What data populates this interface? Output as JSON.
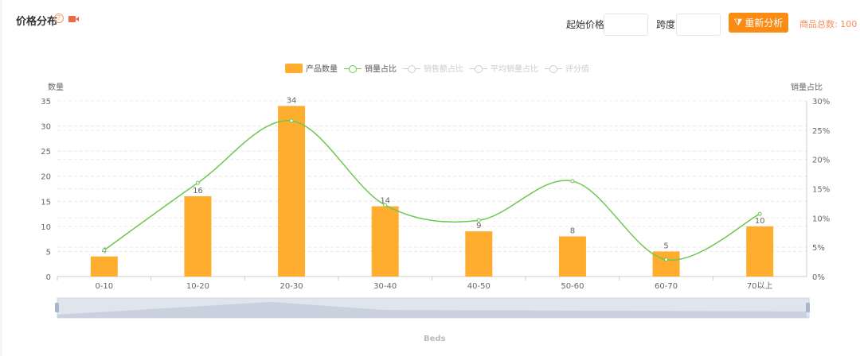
{
  "header": {
    "title": "价格分布",
    "help_icon": "?",
    "start_price_label": "起始价格",
    "start_price_value": "",
    "span_label": "跨度",
    "span_value": "",
    "reanalyze_label": "重新分析",
    "total_label": "商品总数: 100"
  },
  "colors": {
    "bar": "#ffad2e",
    "line": "#6cc84f",
    "accent": "#fa8c16"
  },
  "chart_data": {
    "type": "bar",
    "categories": [
      "0-10",
      "10-20",
      "20-30",
      "30-40",
      "40-50",
      "50-60",
      "60-70",
      "70以上"
    ],
    "series": [
      {
        "name": "产品数量",
        "type": "bar",
        "values": [
          4,
          16,
          34,
          14,
          9,
          8,
          5,
          10
        ],
        "active": true
      },
      {
        "name": "销量占比",
        "type": "line",
        "values": [
          4.5,
          16,
          26.6,
          12.2,
          9.6,
          16.3,
          2.9,
          10.7
        ],
        "active": true
      },
      {
        "name": "销售额占比",
        "type": "line",
        "active": false
      },
      {
        "name": "平均销量占比",
        "type": "line",
        "active": false
      },
      {
        "name": "评分值",
        "type": "line",
        "active": false
      }
    ],
    "ylabel": "数量",
    "ylim": [
      0,
      35
    ],
    "yticks": [
      0,
      5,
      10,
      15,
      20,
      25,
      30,
      35
    ],
    "y2label": "销量占比",
    "y2lim": [
      0,
      30
    ],
    "y2ticks": [
      "0%",
      "5%",
      "10%",
      "15%",
      "20%",
      "25%",
      "30%"
    ],
    "xlabel": "Beds",
    "grid": true,
    "legend": "top-center"
  }
}
